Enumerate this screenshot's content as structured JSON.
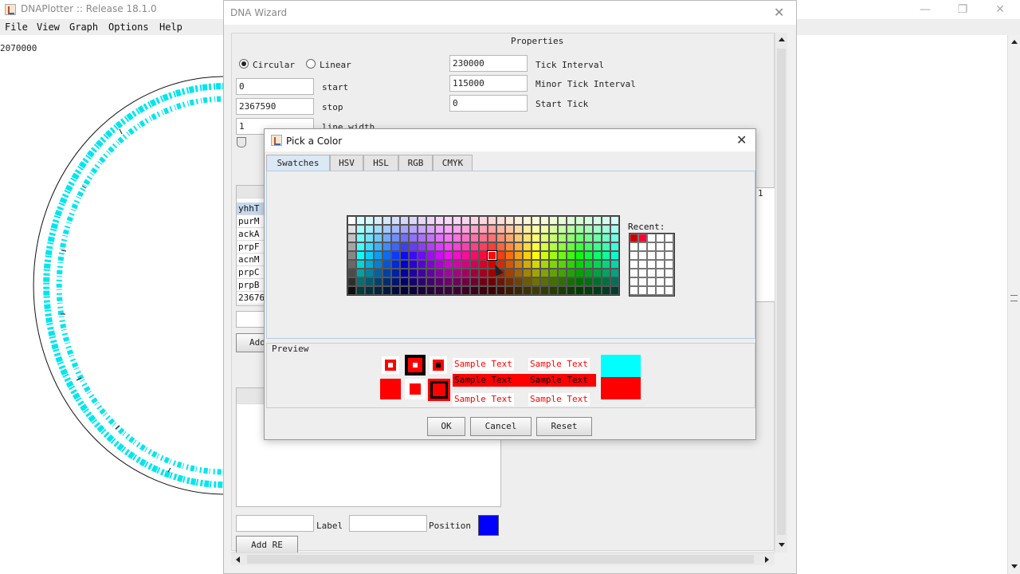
{
  "app": {
    "title": "DNAPlotter :: Release 18.1.0",
    "menu": [
      "File",
      "View",
      "Graph",
      "Options",
      "Help"
    ],
    "coord_readout": "2070000",
    "window_controls": {
      "minimize": "—",
      "restore": "❐",
      "close": "✕"
    }
  },
  "wizard": {
    "title": "DNA Wizard",
    "close": "✕",
    "properties_heading": "Properties",
    "circular_label": "Circular",
    "linear_label": "Linear",
    "start_value": "0",
    "start_label": "start",
    "stop_value": "2367590",
    "stop_label": "stop",
    "line_width_value": "1",
    "line_width_label": "line width",
    "tick_interval_value": "230000",
    "tick_interval_label": "Tick Interval",
    "minor_tick_value": "115000",
    "minor_tick_label": "Minor Tick Interval",
    "start_tick_value": "0",
    "start_tick_label": "Start Tick",
    "list_items": [
      "yhhT",
      "purM",
      "ackA",
      "prpF",
      "acnM",
      "prpC",
      "prpB",
      "23676"
    ],
    "add_button_partial": "Add",
    "label_text": "Label",
    "position_text": "Position",
    "position_color": "#0000ff",
    "add_re_button": "Add RE",
    "right_header_fragment": "1"
  },
  "picker": {
    "title": "Pick a Color",
    "close": "✕",
    "tabs": [
      "Swatches",
      "HSV",
      "HSL",
      "RGB",
      "CMYK"
    ],
    "active_tab": "Swatches",
    "recent_label": "Recent:",
    "recent_colors": [
      "#cc0000",
      "#ff0033"
    ],
    "preview_label": "Preview",
    "sample_text": "Sample Text",
    "selected_color": "#ff0000",
    "preview_swatch_top": "#00ffff",
    "preview_swatch_bottom": "#ff0000",
    "buttons": {
      "ok": "OK",
      "cancel": "Cancel",
      "reset": "Reset"
    }
  },
  "colors": {
    "ring": "#00e5ee",
    "accent_selection": "#c5d9ee"
  }
}
